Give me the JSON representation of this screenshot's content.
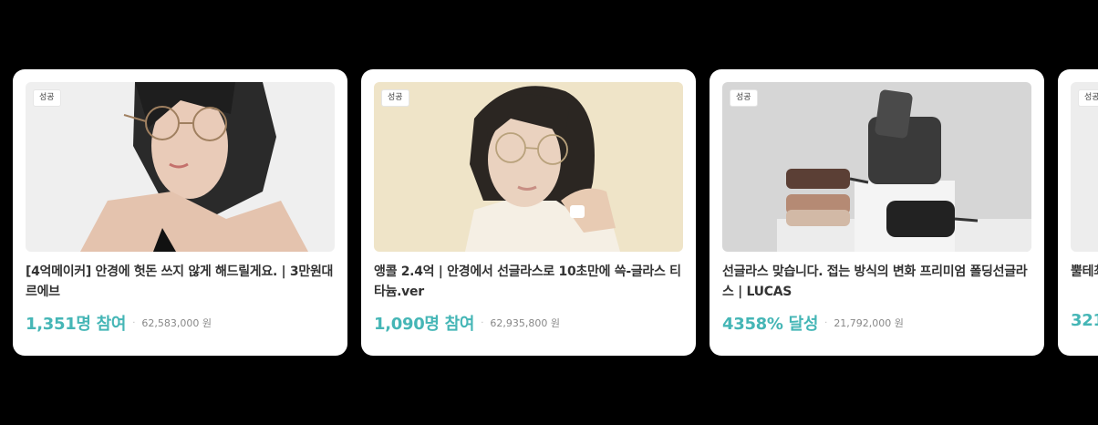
{
  "cards": [
    {
      "badge": "성공",
      "title": "[4억메이커] 안경에 헛돈 쓰지 않게 해드릴게요. | 3만원대 르에브",
      "rate": "1,351명 참여",
      "amount": "62,583,000 원"
    },
    {
      "badge": "성공",
      "title": "앵콜 2.4억 | 안경에서 선글라스로 10초만에 쓱-글라스 티타늄.ver",
      "rate": "1,090명 참여",
      "amount": "62,935,800 원"
    },
    {
      "badge": "성공",
      "title": "선글라스 맞습니다. 접는 방식의 변화 프리미엄 폴딩선글라스 | LUCAS",
      "rate": "4358% 달성",
      "amount": "21,792,000 원"
    },
    {
      "badge": "성공",
      "title": "뿔테최고봉 컬러 DENI",
      "rate": "321",
      "amount": ""
    }
  ],
  "colors": {
    "accent": "#45b6b6",
    "background": "#000000",
    "card": "#ffffff"
  }
}
